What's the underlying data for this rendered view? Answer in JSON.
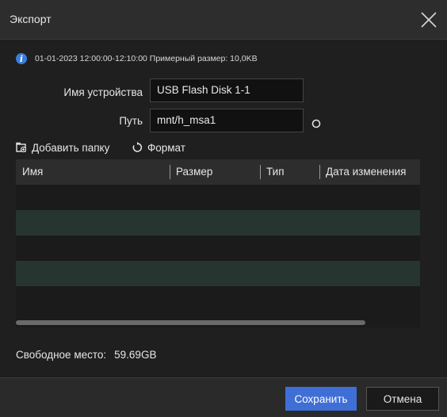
{
  "dialog": {
    "title": "Экспорт"
  },
  "info": {
    "icon": "info-icon",
    "text": "01-01-2023 12:00:00-12:10:00  Примерный размер: 10,0KB"
  },
  "form": {
    "device_label": "Имя устройства",
    "device_value": "USB Flash Disk 1-1",
    "path_label": "Путь",
    "path_value": "mnt/h_msa1"
  },
  "toolbar": {
    "add_folder_label": "Добавить папку",
    "format_label": "Формат"
  },
  "table": {
    "columns": [
      "Имя",
      "Размер",
      "Тип",
      "Дата изменения"
    ],
    "rows": []
  },
  "freespace": {
    "label": "Свободное место:",
    "value": "59.69GB"
  },
  "footer": {
    "save_label": "Сохранить",
    "cancel_label": "Отмена"
  },
  "colors": {
    "accent": "#3f6fd6",
    "info": "#3b7dd8",
    "row_alt": "#263530"
  }
}
